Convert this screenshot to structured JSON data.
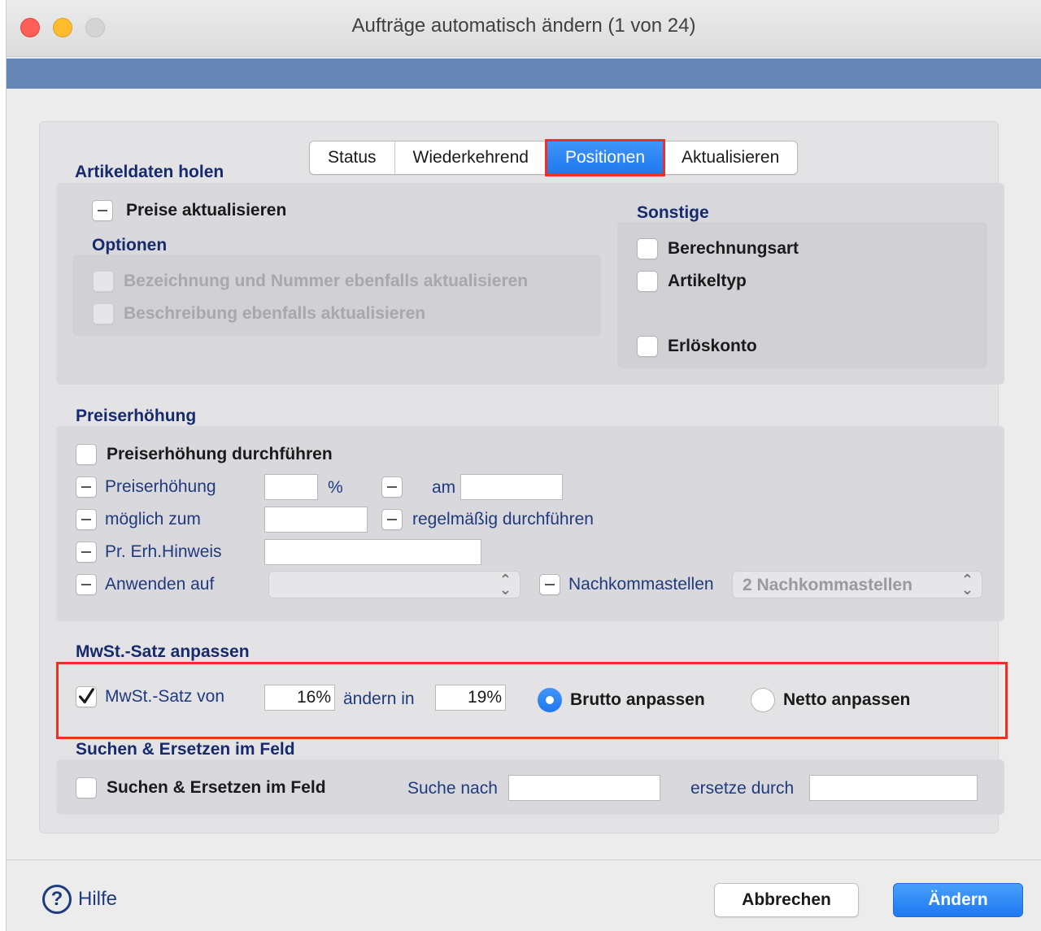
{
  "window": {
    "title": "Aufträge automatisch ändern (1 von 24)"
  },
  "tabs": [
    {
      "label": "Status"
    },
    {
      "label": "Wiederkehrend"
    },
    {
      "label": "Positionen"
    },
    {
      "label": "Aktualisieren"
    }
  ],
  "artikeldaten": {
    "title": "Artikeldaten holen",
    "preise_label": "Preise aktualisieren",
    "optionen_title": "Optionen",
    "opt1_label": "Bezeichnung und Nummer ebenfalls aktualisieren",
    "opt2_label": "Beschreibung ebenfalls aktualisieren",
    "sonstige_title": "Sonstige",
    "berechnungsart_label": "Berechnungsart",
    "artikeltyp_label": "Artikeltyp",
    "erloeskonto_label": "Erlöskonto"
  },
  "preiserhoehung": {
    "title": "Preiserhöhung",
    "durchfuehren_label": "Preiserhöhung durchführen",
    "preiserhoehung_label": "Preiserhöhung",
    "percent_value": "",
    "percent_unit": "%",
    "am_label": "am",
    "am_value": "",
    "moeglich_label": "möglich zum",
    "moeglich_value": "",
    "regelmaessig_label": "regelmäßig durchführen",
    "hinweis_label": "Pr. Erh.Hinweis",
    "hinweis_value": "",
    "anwenden_label": "Anwenden auf",
    "anwenden_value": "",
    "nachkommastellen_label": "Nachkommastellen",
    "nachkommastellen_value": "2 Nachkommastellen"
  },
  "mwst": {
    "title": "MwSt.-Satz anpassen",
    "von_label": "MwSt.-Satz von",
    "von_value": "16%",
    "aendern_label": "ändern in",
    "in_value": "19%",
    "brutto_label": "Brutto anpassen",
    "netto_label": "Netto anpassen"
  },
  "suchen": {
    "title": "Suchen & Ersetzen im Feld",
    "checkbox_label": "Suchen & Ersetzen im Feld",
    "suche_label": "Suche nach",
    "suche_value": "",
    "ersetze_label": "ersetze durch",
    "ersetze_value": ""
  },
  "footer": {
    "help_label": "Hilfe",
    "cancel_label": "Abbrechen",
    "submit_label": "Ändern"
  }
}
